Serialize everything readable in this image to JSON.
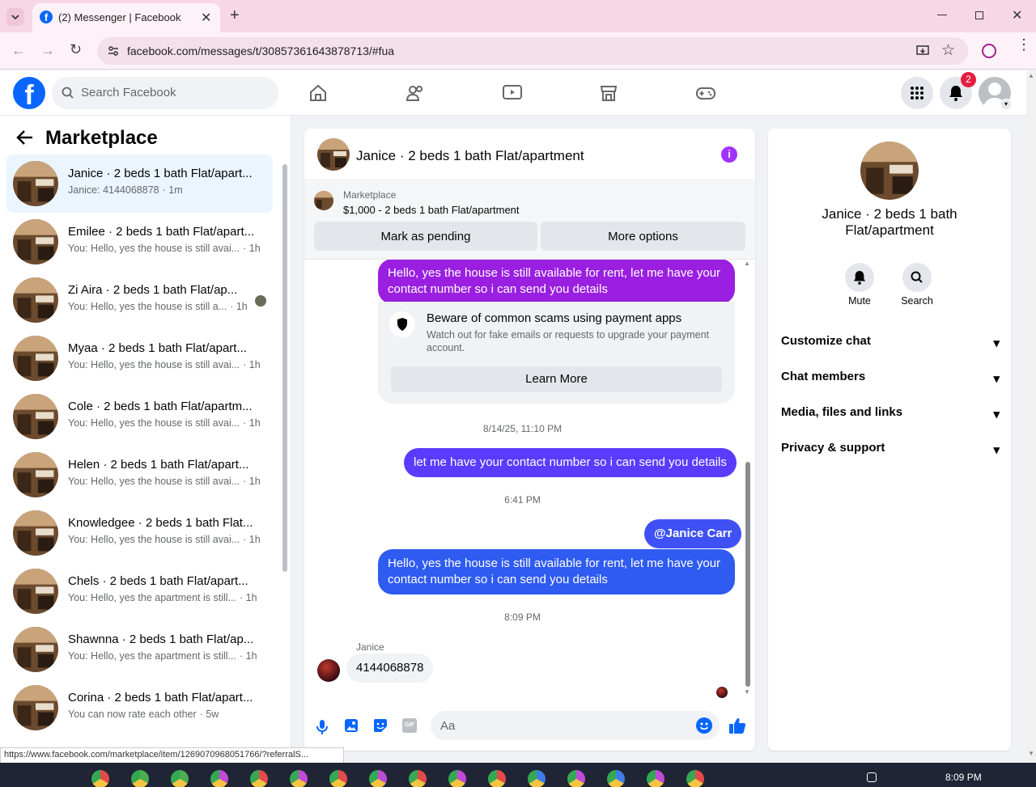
{
  "browser": {
    "tab_title": "(2) Messenger | Facebook",
    "url": "facebook.com/messages/t/30857361643878713/#fua",
    "status_url": "https://www.facebook.com/marketplace/item/1269070968051766/?referralS..."
  },
  "fb": {
    "search_placeholder": "Search Facebook",
    "notification_count": "2",
    "brand_color": "#0866ff"
  },
  "left": {
    "title": "Marketplace",
    "conversations": [
      {
        "name": "Janice · 2 beds 1 bath Flat/apart...",
        "preview": "Janice: 4144068878",
        "time": "· 1m",
        "active": true
      },
      {
        "name": "Emilee · 2 beds 1 bath Flat/apart...",
        "preview": "You: Hello, yes the house is still avai...",
        "time": "· 1h"
      },
      {
        "name": "Zi Aira · 2 beds 1 bath Flat/ap...",
        "preview": "You: Hello, yes the house is still a...",
        "time": "· 1h"
      },
      {
        "name": "Myaa · 2 beds 1 bath Flat/apart...",
        "preview": "You: Hello, yes the house is still avai...",
        "time": "· 1h"
      },
      {
        "name": "Cole · 2 beds 1 bath Flat/apartm...",
        "preview": "You: Hello, yes the house is still avai...",
        "time": "· 1h"
      },
      {
        "name": "Helen · 2 beds 1 bath Flat/apart...",
        "preview": "You: Hello, yes the house is still avai...",
        "time": "· 1h"
      },
      {
        "name": "Knowledgee · 2 beds 1 bath Flat...",
        "preview": "You: Hello, yes the house is still avai...",
        "time": "· 1h"
      },
      {
        "name": "Chels · 2 beds 1 bath Flat/apart...",
        "preview": "You: Hello, yes the apartment is still...",
        "time": "· 1h"
      },
      {
        "name": "Shawnna · 2 beds 1 bath Flat/ap...",
        "preview": "You: Hello, yes the apartment is still...",
        "time": "· 1h"
      },
      {
        "name": "Corina · 2 beds 1 bath Flat/apart...",
        "preview": "You can now rate each other",
        "time": "· 5w"
      }
    ]
  },
  "chat": {
    "title": "Janice · 2 beds 1 bath Flat/apartment",
    "marketplace_label": "Marketplace",
    "listing": "$1,000 - 2 beds 1 bath Flat/apartment",
    "mark_pending": "Mark as pending",
    "more_options": "More options",
    "msg1": "Hello, yes the house is still available for rent, let me have your contact number so i can send you details",
    "scam_title": "Beware of common scams using payment apps",
    "scam_body": "Watch out for fake emails or requests to upgrade your payment account.",
    "learn_more": "Learn More",
    "ts1": "8/14/25, 11:10 PM",
    "msg2": "let me have your contact number so i can send you details",
    "ts2": "6:41 PM",
    "mention": "@Janice Carr",
    "msg3": "Hello, yes the house is still available for rent, let me have your contact number so i can send you details",
    "ts3": "8:09 PM",
    "sender": "Janice",
    "reply": "4144068878",
    "composer_placeholder": "Aa"
  },
  "right": {
    "name": "Janice · 2 beds 1 bath Flat/apartment",
    "mute": "Mute",
    "search": "Search",
    "sections": [
      "Customize chat",
      "Chat members",
      "Media, files and links",
      "Privacy & support"
    ]
  },
  "taskbar": {
    "time": "8:09 PM"
  }
}
